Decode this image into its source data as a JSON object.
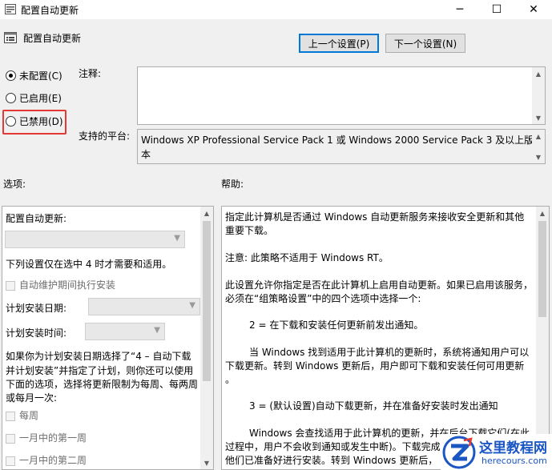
{
  "window": {
    "title": "配置自动更新",
    "minimize": "─",
    "maximize": "☐",
    "close": "✕"
  },
  "header": {
    "policy_title": "配置自动更新",
    "prev_button": "上一个设置(P)",
    "next_button": "下一个设置(N)"
  },
  "state_options": [
    {
      "label": "未配置(C)",
      "selected": true
    },
    {
      "label": "已启用(E)",
      "selected": false
    },
    {
      "label": "已禁用(D)",
      "selected": false
    }
  ],
  "comment": {
    "label": "注释:",
    "value": ""
  },
  "platform": {
    "label": "支持的平台:",
    "line1": "Windows XP Professional Service Pack 1 或 Windows 2000 Service Pack 3 及以上版",
    "line2": "本"
  },
  "options": {
    "label": "选项:",
    "configure_label": "配置自动更新:",
    "note": "下列设置仅在选中 4 时才需要和适用。",
    "maintenance_checkbox": "自动维护期间执行安装",
    "install_day_label": "计划安装日期:",
    "install_time_label": "计划安装时间:",
    "para_lines": [
      "如果你为计划安装日期选择了“4 – 自动下载",
      "并计划安装”并指定了计划，则你还可以使用",
      "下面的选项，选择将更新限制为每周、每两周",
      "或每月一次:"
    ],
    "weekly": "每周",
    "first_week": "一月中的第一周",
    "second_week": "一月中的第二周"
  },
  "help": {
    "label": "帮助:",
    "lines": [
      "指定此计算机是否通过 Windows 自动更新服务来接收安全更新和其他",
      "重要下载。",
      "注意: 此策略不适用于 Windows RT。",
      "此设置允许你指定是否在此计算机上启用自动更新。如果已启用该服务，",
      "必须在“组策略设置”中的四个选项中选择一个:",
      "2 = 在下载和安装任何更新前发出通知。",
      "当 Windows 找到适用于此计算机的更新时，系统将通知用户可以",
      "下载更新。转到 Windows 更新后，用户即可下载和安装任何可用更新",
      "。",
      "3 = (默认设置)自动下载更新，并在准备好安装时发出通知",
      "Windows 会查找适用于此计算机的更新，并在后台下载它们(在此",
      "过程中，用户不会收到通知或发生中断)。下载完成",
      "他们已准备好进行安装。转到 Windows 更新后，"
    ]
  },
  "watermark": {
    "title": "这里教程网",
    "url": "herecours.com"
  },
  "colors": {
    "highlight": "#e53935",
    "focus_border": "#0078d7",
    "watermark_blue": "#1a56c4"
  }
}
